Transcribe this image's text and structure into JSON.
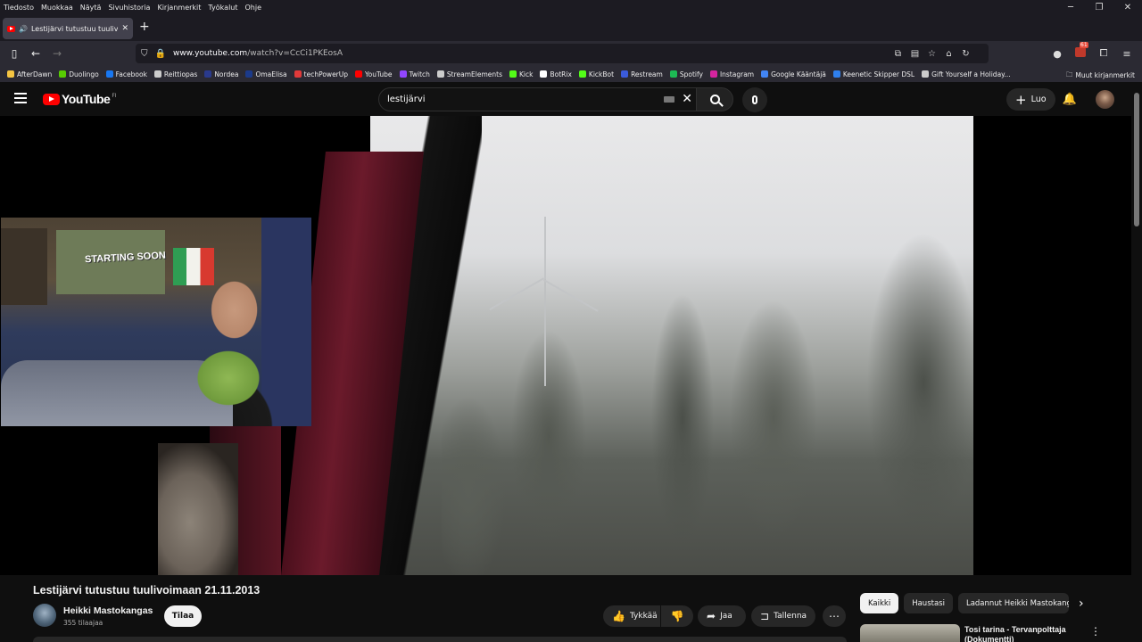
{
  "browser": {
    "menu": [
      "Tiedosto",
      "Muokkaa",
      "Näytä",
      "Sivuhistoria",
      "Kirjanmerkit",
      "Työkalut",
      "Ohje"
    ],
    "tab_title": "Lestijärvi tutustuu tuulivoi",
    "url_host": "www.youtube.com",
    "url_path": "/watch?v=CcCi1PKEosA",
    "extension_badge": "61",
    "bookmarks": [
      {
        "label": "AfterDawn",
        "color": "#f5c542"
      },
      {
        "label": "Duolingo",
        "color": "#58cc02"
      },
      {
        "label": "Facebook",
        "color": "#1877f2"
      },
      {
        "label": "Reittiopas",
        "color": "#cccccc"
      },
      {
        "label": "Nordea",
        "color": "#2a3a8c"
      },
      {
        "label": "OmaElisa",
        "color": "#1b3a8a"
      },
      {
        "label": "techPowerUp",
        "color": "#e03a3a"
      },
      {
        "label": "YouTube",
        "color": "#ff0000"
      },
      {
        "label": "Twitch",
        "color": "#9146ff"
      },
      {
        "label": "StreamElements",
        "color": "#cccccc"
      },
      {
        "label": "Kick",
        "color": "#53fc18"
      },
      {
        "label": "BotRix",
        "color": "#ffffff"
      },
      {
        "label": "KickBot",
        "color": "#53fc18"
      },
      {
        "label": "Restream",
        "color": "#3b5bdb"
      },
      {
        "label": "Spotify",
        "color": "#1db954"
      },
      {
        "label": "Instagram",
        "color": "#d6249f"
      },
      {
        "label": "Google Kääntäjä",
        "color": "#4285f4"
      },
      {
        "label": "Keenetic Skipper DSL",
        "color": "#2f80ed"
      },
      {
        "label": "Gift Yourself a Holiday...",
        "color": "#cccccc"
      }
    ],
    "other_bookmarks": "Muut kirjanmerkit"
  },
  "youtube": {
    "logo_text": "YouTube",
    "logo_country": "FI",
    "search_value": "lestijärvi",
    "create_label": "Luo",
    "stream_poster_text": "STARTING SOON",
    "video": {
      "title": "Lestijärvi tutustuu tuulivoimaan 21.11.2013",
      "channel": "Heikki Mastokangas",
      "subscribers": "355 tilaajaa",
      "subscribe_label": "Tilaa",
      "like_label": "Tykkää",
      "share_label": "Jaa",
      "save_label": "Tallenna"
    },
    "chips": [
      "Kaikki",
      "Haustasi",
      "Ladannut Heikki Mastokangas"
    ],
    "recommended": {
      "title": "Tosi tarina - Tervanpolttaja (Dokumentti)"
    }
  }
}
